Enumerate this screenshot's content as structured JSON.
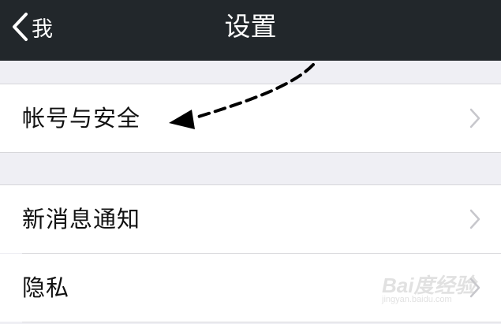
{
  "navbar": {
    "back_label": "我",
    "title": "设置"
  },
  "sections": [
    {
      "items": [
        {
          "label": "帐号与安全"
        }
      ]
    },
    {
      "items": [
        {
          "label": "新消息通知"
        },
        {
          "label": "隐私"
        }
      ]
    }
  ],
  "icons": {
    "back": "chevron-left-icon",
    "row_disclosure": "chevron-right-icon"
  },
  "annotation": {
    "type": "dashed-arrow",
    "target": "帐号与安全"
  },
  "watermark": {
    "main": "Bai度经验",
    "sub": "jingyan.baidu.com"
  },
  "colors": {
    "navbar_bg": "#22272b",
    "navbar_text": "#ffffff",
    "page_bg": "#efeff4",
    "cell_bg": "#ffffff",
    "chevron": "#c7c7cc"
  }
}
